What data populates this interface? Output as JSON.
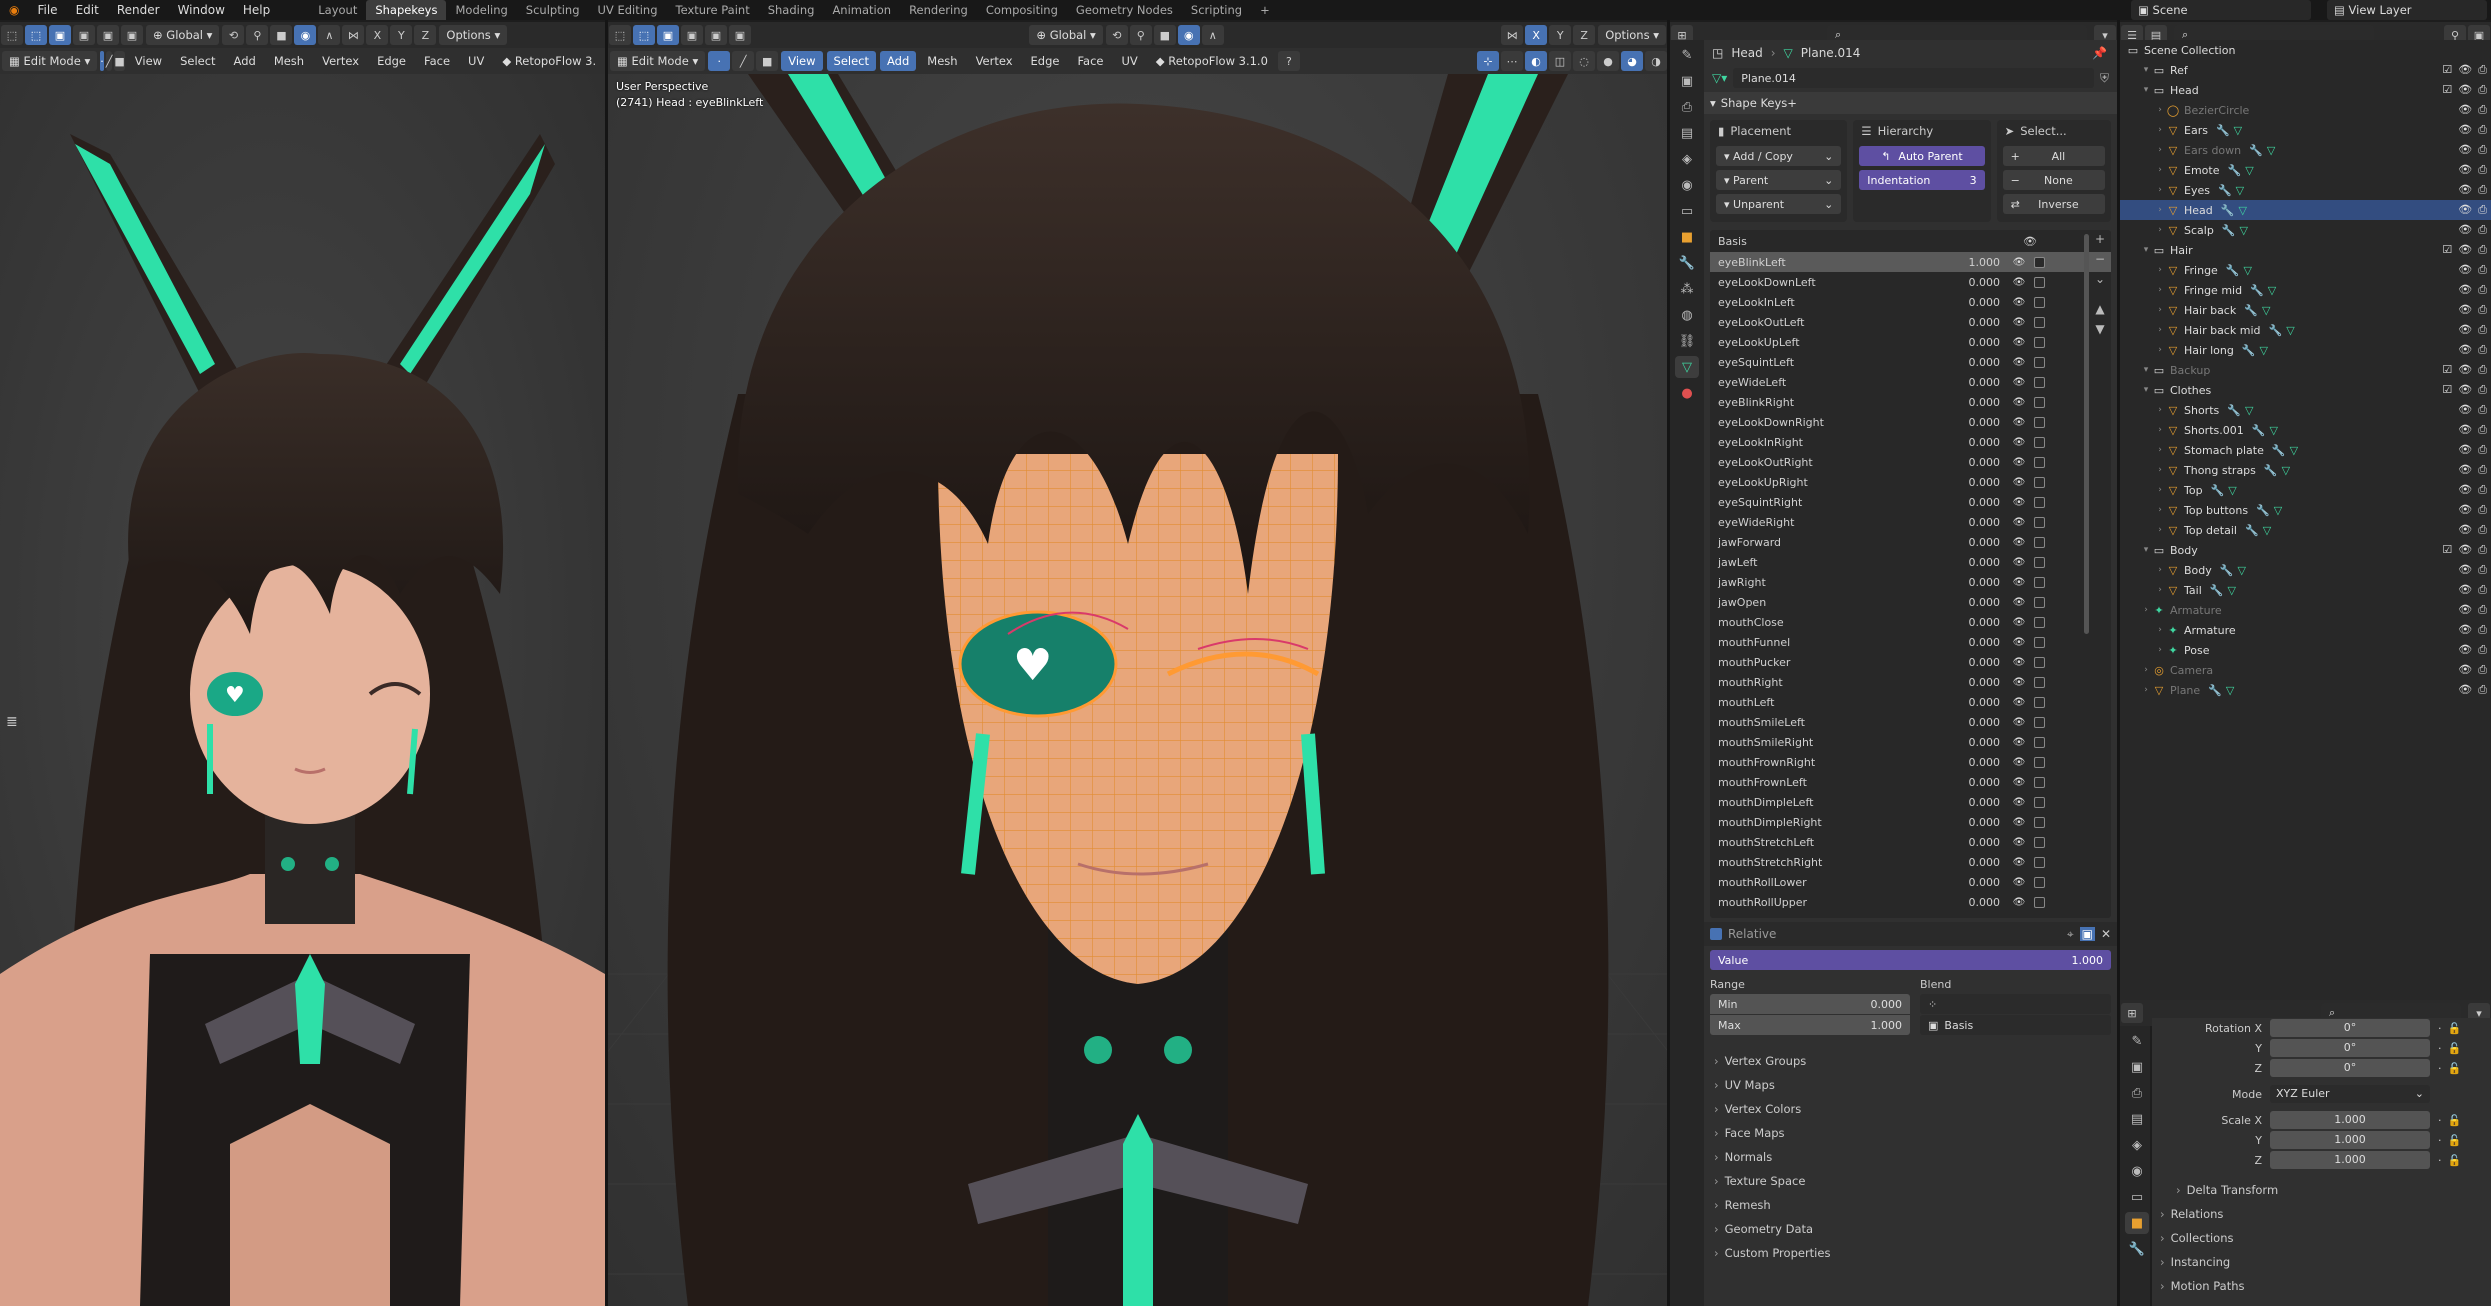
{
  "menubar": {
    "menus": [
      "File",
      "Edit",
      "Render",
      "Window",
      "Help"
    ],
    "workspace_tabs": [
      "Layout",
      "Shapekeys",
      "Modeling",
      "Sculpting",
      "UV Editing",
      "Texture Paint",
      "Shading",
      "Animation",
      "Rendering",
      "Compositing",
      "Geometry Nodes",
      "Scripting"
    ],
    "active_tab": "Shapekeys",
    "add_tab": "+",
    "scene_label": "Scene",
    "view_layer_label": "View Layer"
  },
  "left_viewport": {
    "header": {
      "orientation": "Global",
      "options": "Options"
    },
    "header2": {
      "mode": "Edit Mode",
      "menus": [
        "View",
        "Select",
        "Add",
        "Mesh",
        "Vertex",
        "Edge",
        "Face",
        "UV"
      ],
      "addon": "RetopoFlow 3."
    }
  },
  "main_viewport": {
    "header": {
      "orientation": "Global",
      "options": "Options"
    },
    "header2": {
      "mode": "Edit Mode",
      "menus": [
        "View",
        "Select",
        "Add",
        "Mesh",
        "Vertex",
        "Edge",
        "Face",
        "UV"
      ],
      "addon": "RetopoFlow 3.1.0"
    },
    "overlay_line1": "User Perspective",
    "overlay_line2": "(2741) Head : eyeBlinkLeft"
  },
  "properties": {
    "breadcrumb_object": "Head",
    "breadcrumb_mesh": "Plane.014",
    "mesh_name": "Plane.014",
    "shape_keys_header": "Shape Keys+",
    "placement": {
      "title": "Placement",
      "add_copy": "Add / Copy",
      "parent": "Parent",
      "unparent": "Unparent"
    },
    "hierarchy": {
      "title": "Hierarchy",
      "auto_parent": "Auto Parent",
      "indentation_label": "Indentation",
      "indentation_value": "3"
    },
    "select": {
      "title": "Select...",
      "all": "All",
      "none": "None",
      "inverse": "Inverse"
    },
    "basis": "Basis",
    "shape_keys": [
      {
        "name": "eyeBlinkLeft",
        "value": "1.000",
        "selected": true
      },
      {
        "name": "eyeLookDownLeft",
        "value": "0.000"
      },
      {
        "name": "eyeLookInLeft",
        "value": "0.000"
      },
      {
        "name": "eyeLookOutLeft",
        "value": "0.000"
      },
      {
        "name": "eyeLookUpLeft",
        "value": "0.000"
      },
      {
        "name": "eyeSquintLeft",
        "value": "0.000"
      },
      {
        "name": "eyeWideLeft",
        "value": "0.000"
      },
      {
        "name": "eyeBlinkRight",
        "value": "0.000"
      },
      {
        "name": "eyeLookDownRight",
        "value": "0.000"
      },
      {
        "name": "eyeLookInRight",
        "value": "0.000"
      },
      {
        "name": "eyeLookOutRight",
        "value": "0.000"
      },
      {
        "name": "eyeLookUpRight",
        "value": "0.000"
      },
      {
        "name": "eyeSquintRight",
        "value": "0.000"
      },
      {
        "name": "eyeWideRight",
        "value": "0.000"
      },
      {
        "name": "jawForward",
        "value": "0.000"
      },
      {
        "name": "jawLeft",
        "value": "0.000"
      },
      {
        "name": "jawRight",
        "value": "0.000"
      },
      {
        "name": "jawOpen",
        "value": "0.000"
      },
      {
        "name": "mouthClose",
        "value": "0.000"
      },
      {
        "name": "mouthFunnel",
        "value": "0.000"
      },
      {
        "name": "mouthPucker",
        "value": "0.000"
      },
      {
        "name": "mouthRight",
        "value": "0.000"
      },
      {
        "name": "mouthLeft",
        "value": "0.000"
      },
      {
        "name": "mouthSmileLeft",
        "value": "0.000"
      },
      {
        "name": "mouthSmileRight",
        "value": "0.000"
      },
      {
        "name": "mouthFrownRight",
        "value": "0.000"
      },
      {
        "name": "mouthFrownLeft",
        "value": "0.000"
      },
      {
        "name": "mouthDimpleLeft",
        "value": "0.000"
      },
      {
        "name": "mouthDimpleRight",
        "value": "0.000"
      },
      {
        "name": "mouthStretchLeft",
        "value": "0.000"
      },
      {
        "name": "mouthStretchRight",
        "value": "0.000"
      },
      {
        "name": "mouthRollLower",
        "value": "0.000"
      },
      {
        "name": "mouthRollUpper",
        "value": "0.000"
      }
    ],
    "relative": "Relative",
    "value_label": "Value",
    "value": "1.000",
    "value_fraction": 1.0,
    "range_label": "Range",
    "min_label": "Min",
    "min_value": "0.000",
    "max_label": "Max",
    "max_value": "1.000",
    "blend_label": "Blend",
    "blend_value": "Basis",
    "collapsed_panels": [
      "Vertex Groups",
      "UV Maps",
      "Vertex Colors",
      "Face Maps",
      "Normals",
      "Texture Space",
      "Remesh",
      "Geometry Data",
      "Custom Properties"
    ]
  },
  "outliner": {
    "scene_collection": "Scene Collection",
    "rows": [
      {
        "label": "Ref",
        "depth": 1,
        "kind": "collection"
      },
      {
        "label": "Head",
        "depth": 1,
        "kind": "collection"
      },
      {
        "label": "BezierCircle",
        "depth": 2,
        "kind": "curve",
        "dim": true
      },
      {
        "label": "Ears",
        "depth": 2,
        "kind": "mesh"
      },
      {
        "label": "Ears down",
        "depth": 2,
        "kind": "mesh",
        "dim": true
      },
      {
        "label": "Emote",
        "depth": 2,
        "kind": "mesh"
      },
      {
        "label": "Eyes",
        "depth": 2,
        "kind": "mesh"
      },
      {
        "label": "Head",
        "depth": 2,
        "kind": "mesh",
        "selected": true
      },
      {
        "label": "Scalp",
        "depth": 2,
        "kind": "mesh"
      },
      {
        "label": "Hair",
        "depth": 1,
        "kind": "collection"
      },
      {
        "label": "Fringe",
        "depth": 2,
        "kind": "mesh"
      },
      {
        "label": "Fringe mid",
        "depth": 2,
        "kind": "mesh"
      },
      {
        "label": "Hair back",
        "depth": 2,
        "kind": "mesh"
      },
      {
        "label": "Hair back mid",
        "depth": 2,
        "kind": "mesh"
      },
      {
        "label": "Hair long",
        "depth": 2,
        "kind": "mesh"
      },
      {
        "label": "Backup",
        "depth": 1,
        "kind": "collection",
        "dim": true
      },
      {
        "label": "Clothes",
        "depth": 1,
        "kind": "collection"
      },
      {
        "label": "Shorts",
        "depth": 2,
        "kind": "mesh"
      },
      {
        "label": "Shorts.001",
        "depth": 2,
        "kind": "mesh"
      },
      {
        "label": "Stomach plate",
        "depth": 2,
        "kind": "mesh"
      },
      {
        "label": "Thong straps",
        "depth": 2,
        "kind": "mesh"
      },
      {
        "label": "Top",
        "depth": 2,
        "kind": "mesh"
      },
      {
        "label": "Top buttons",
        "depth": 2,
        "kind": "mesh"
      },
      {
        "label": "Top detail",
        "depth": 2,
        "kind": "mesh"
      },
      {
        "label": "Body",
        "depth": 1,
        "kind": "collection"
      },
      {
        "label": "Body",
        "depth": 2,
        "kind": "mesh"
      },
      {
        "label": "Tail",
        "depth": 2,
        "kind": "mesh"
      },
      {
        "label": "Armature",
        "depth": 1,
        "kind": "armature",
        "dim": true
      },
      {
        "label": "Armature",
        "depth": 2,
        "kind": "armature"
      },
      {
        "label": "Pose",
        "depth": 2,
        "kind": "pose"
      },
      {
        "label": "Camera",
        "depth": 1,
        "kind": "camera",
        "dim": true
      },
      {
        "label": "Plane",
        "depth": 1,
        "kind": "mesh",
        "dim": true
      }
    ]
  },
  "object_props": {
    "rotation_x_label": "Rotation X",
    "rotation_x": "0°",
    "rotation_y_label": "Y",
    "rotation_y": "0°",
    "rotation_z_label": "Z",
    "rotation_z": "0°",
    "mode_label": "Mode",
    "mode_value": "XYZ Euler",
    "scale_x_label": "Scale X",
    "scale_x": "1.000",
    "scale_y_label": "Y",
    "scale_y": "1.000",
    "scale_z_label": "Z",
    "scale_z": "1.000",
    "panels": [
      "Delta Transform",
      "Relations",
      "Collections",
      "Instancing",
      "Motion Paths"
    ]
  },
  "colors": {
    "accent_blue": "#4772b3",
    "accent_purple": "#5e4fa2",
    "mesh_orange": "#e08a2a",
    "teal": "#2fd6a4"
  }
}
